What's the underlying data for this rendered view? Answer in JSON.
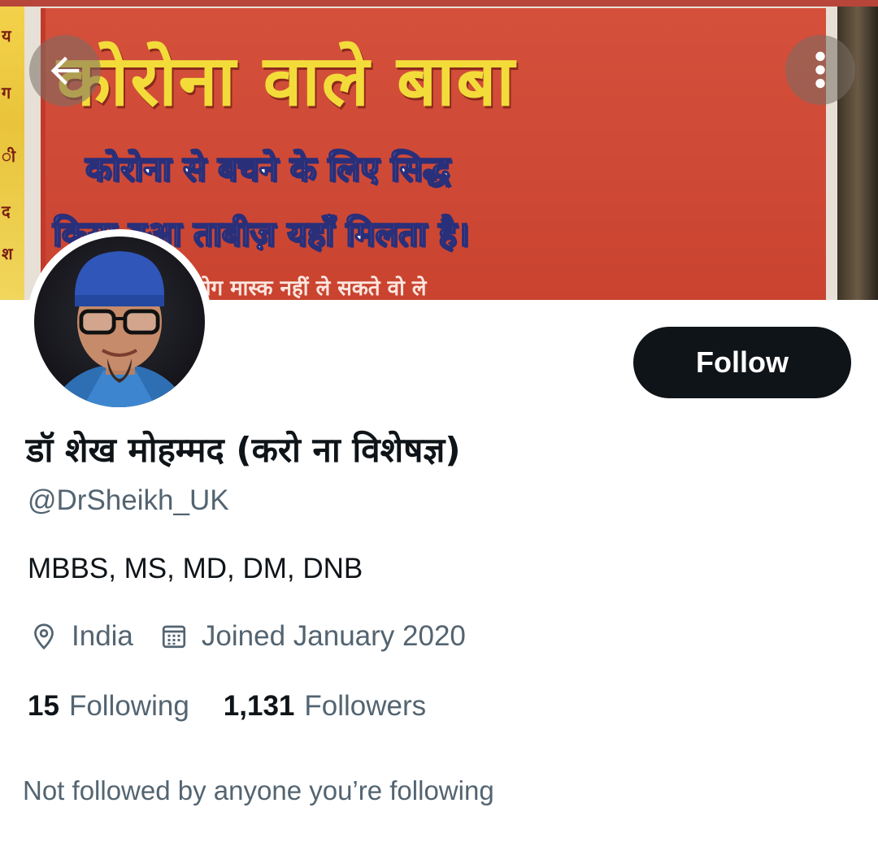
{
  "banner": {
    "line1": "कोरोना वाले बाबा",
    "line2": "कोरोना से बचने के लिए सिद्ध",
    "line3": "किया हुआ ताबीज़ यहाँ मिलता है।",
    "line4": "जो लोग मास्क नहीं ले सकते वो ले",
    "colors": {
      "banner_red": "#d4503b",
      "banner_yellow": "#f3dc3a"
    }
  },
  "nav": {
    "back_icon": "arrow-left-icon",
    "more_icon": "more-vertical-icon"
  },
  "profile": {
    "display_name": "डॉ शेख मोहम्मद (करो ना विशेषज्ञ)",
    "handle": "@DrSheikh_UK",
    "bio": "MBBS, MS, MD, DM, DNB",
    "location": "India",
    "joined": "Joined January 2020",
    "following_count": "15",
    "following_label": "Following",
    "followers_count": "1,131",
    "followers_label": "Followers",
    "mutuals_text": "Not followed by anyone you’re following"
  },
  "actions": {
    "follow_label": "Follow"
  },
  "colors": {
    "text_primary": "#0f1419",
    "text_secondary": "#536471",
    "button_bg": "#0f1419"
  }
}
